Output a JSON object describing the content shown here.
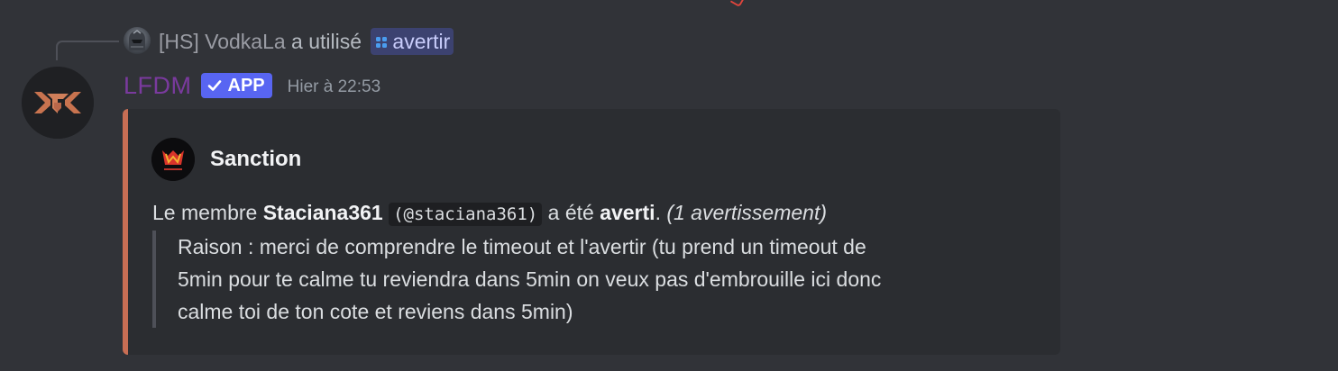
{
  "reply": {
    "user": "[HS] VodkaLa",
    "action": "a utilisé",
    "command": "avertir"
  },
  "message": {
    "author": "LFDM",
    "badge": "APP",
    "timestamp": "Hier à 22:53"
  },
  "embed": {
    "accent_color": "#c86e54",
    "author_name": "Sanction",
    "desc_prefix": "Le membre ",
    "member_name": "Staciana361",
    "member_handle": "(@staciana361)",
    "desc_middle": " a été ",
    "action_word": "averti",
    "desc_period": ".",
    "count_text": "(1 avertissement)",
    "reason_lines": [
      "Raison : merci de comprendre le timeout et l'avertir (tu prend un timeout de",
      "5min pour te calme tu reviendra dans 5min on veux pas d'embrouille ici donc",
      "calme toi de ton cote et reviens dans 5min)"
    ]
  },
  "colors": {
    "background": "#313338",
    "username": "#7a3a9e",
    "badge": "#5865f2",
    "command_highlight": "#3c4270"
  },
  "icons": {
    "reply_avatar": "helmet-avatar-icon",
    "command": "slash-command-icon",
    "badge_check": "check-icon",
    "bot_avatar": "lfdm-logo-icon",
    "embed_author": "sanction-logo-icon"
  }
}
